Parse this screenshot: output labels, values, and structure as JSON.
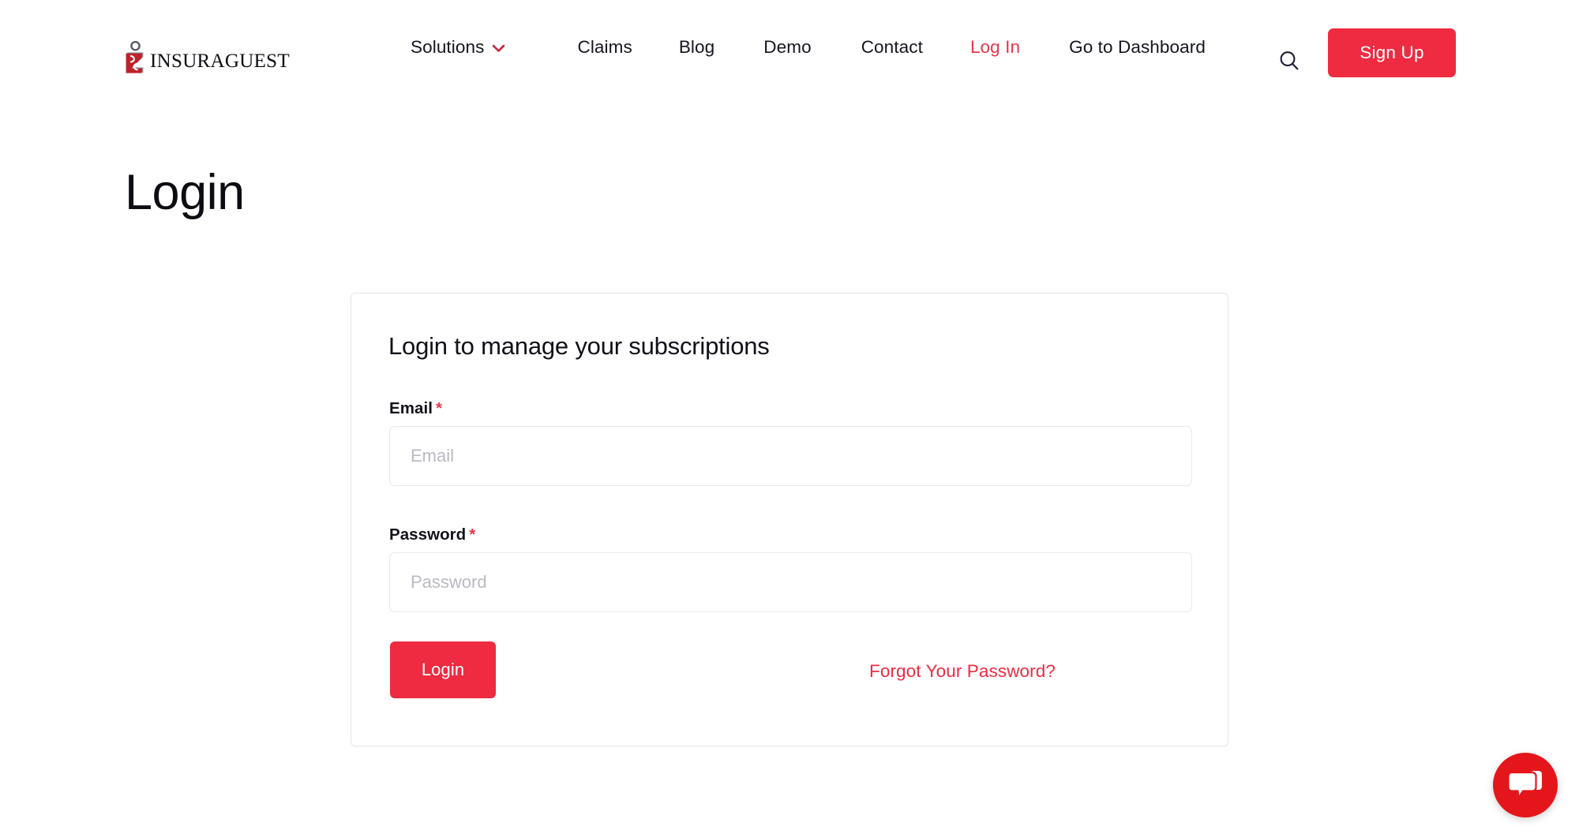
{
  "brand": {
    "name": "InsuraGuest",
    "logo_icon": "insuraguest-figure-logo",
    "mark_colors": {
      "head": "#5a5a63",
      "body_red": "#c0202a",
      "body_gray": "#8a8a93"
    }
  },
  "colors": {
    "brand_red": "#ee2b40",
    "link_red": "#e8364b",
    "chat_red": "#e5161b",
    "text_dark": "#14141e",
    "placeholder": "#b9bac2",
    "card_border": "#e6e7eb",
    "input_border": "#e7e8ec",
    "page_bg": "#ffffff"
  },
  "nav": {
    "items": [
      {
        "label": "Solutions",
        "icon": "chevron-down-icon",
        "has_dropdown": true,
        "active": false
      },
      {
        "label": "Claims",
        "has_dropdown": false,
        "active": false
      },
      {
        "label": "Blog",
        "has_dropdown": false,
        "active": false
      },
      {
        "label": "Demo",
        "has_dropdown": false,
        "active": false
      },
      {
        "label": "Contact",
        "has_dropdown": false,
        "active": false
      },
      {
        "label": "Log In",
        "has_dropdown": false,
        "active": true
      },
      {
        "label": "Go to Dashboard",
        "has_dropdown": false,
        "active": false
      }
    ],
    "search_icon": "search-icon",
    "signup_label": "Sign Up"
  },
  "hero": {
    "title": "Login"
  },
  "login_form": {
    "heading": "Login to manage your subscriptions",
    "required_marker": "*",
    "fields": [
      {
        "label": "Email",
        "placeholder": "Email",
        "value": "",
        "required": true,
        "type": "email"
      },
      {
        "label": "Password",
        "placeholder": "Password",
        "value": "",
        "required": true,
        "type": "password"
      }
    ],
    "submit_label": "Login",
    "forgot_label": "Forgot Your Password?"
  },
  "chat": {
    "icon": "chat-bubble-icon",
    "label": "Open chat"
  }
}
